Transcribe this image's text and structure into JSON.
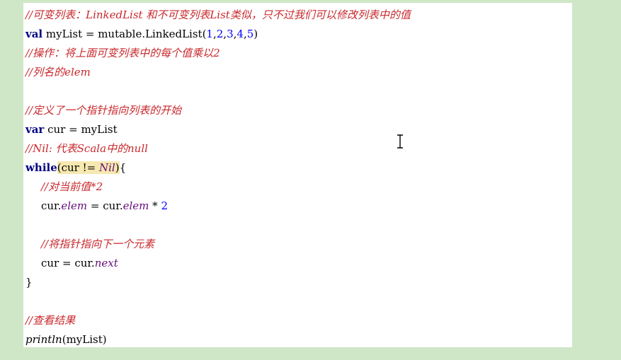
{
  "code_lines": {
    "l1_comment": "//可变列表：LinkedList 和不可变列表List类似，只不过我们可以修改列表中的值",
    "l2_kw": "val",
    "l2_text": " myList = mutable.LinkedList(",
    "l2_nums": [
      "1",
      "2",
      "3",
      "4",
      "5"
    ],
    "l3_comment": "//操作：将上面可变列表中的每个值乘以2",
    "l4_comment": "//列名的elem",
    "l6_comment": "//定义了一个指针指向列表的开始",
    "l7_kw": "var",
    "l7_text": " cur = myList",
    "l8_comment": "//Nil: 代表Scala中的null",
    "l9_kw": "while",
    "l9_open": "(",
    "l9_cond": "cur != ",
    "l9_nil": "Nil",
    "l9_close": ")",
    "l9_brace": "{",
    "l10_comment": "//对当前值*2",
    "l11_cur1": "cur.",
    "l11_elem1": "elem",
    "l11_mid": " = cur.",
    "l11_elem2": "elem",
    "l11_op": " * ",
    "l11_num": "2",
    "l13_comment": "//将指针指向下一个元素",
    "l14_text": "cur = cur.",
    "l14_next": "next",
    "l15_brace": "}",
    "l17_comment": "//查看结果",
    "l18_fn": "println",
    "l18_args": "(myList)"
  },
  "colors": {
    "background": "#cfe6c7",
    "editor": "#ffffff",
    "comment": "#c8282c",
    "keyword": "#000080",
    "number": "#0000ff",
    "field": "#660e7a",
    "highlight": "#f6e8b0"
  },
  "icons": {
    "cursor": "text-ibeam-cursor-icon"
  }
}
